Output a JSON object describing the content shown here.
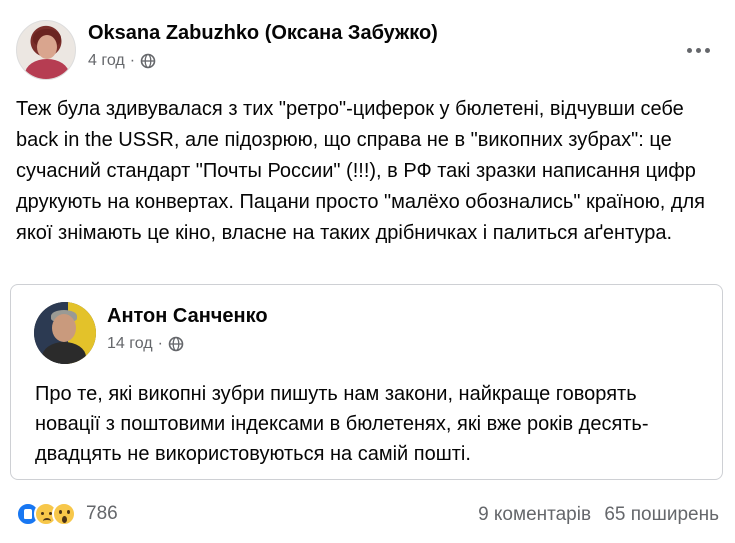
{
  "post": {
    "author": "Oksana Zabuzhko (Оксана Забужко)",
    "time": "4 год",
    "dot": "·",
    "text": "Теж була здивувалася з тих \"ретро\"-циферок у бюлетені, відчувши себе back in the USSR, але підозрюю, що справа не в \"викопних зубрах\": це сучасний стандарт \"Почты России\" (!!!), в РФ такі зразки написання цифр друкують на конвертах. Пацани просто \"малёхо обознались\" країною, для якої знімають це кіно, власне на таких дрібничках і палиться аґентура."
  },
  "shared": {
    "author": "Антон Санченко",
    "time": "14 год",
    "dot": "·",
    "text": "Про те, які викопні зубри пишуть нам закони, найкраще говорять новації з поштовими індексами в бюлетенях, які вже років десять-двадцять не використовуються на самій пошті."
  },
  "footer": {
    "reaction_count": "786",
    "reactions": [
      "like-icon",
      "sad-icon",
      "wow-icon"
    ],
    "comments": "9 коментарів",
    "shares": "65 поширень"
  }
}
